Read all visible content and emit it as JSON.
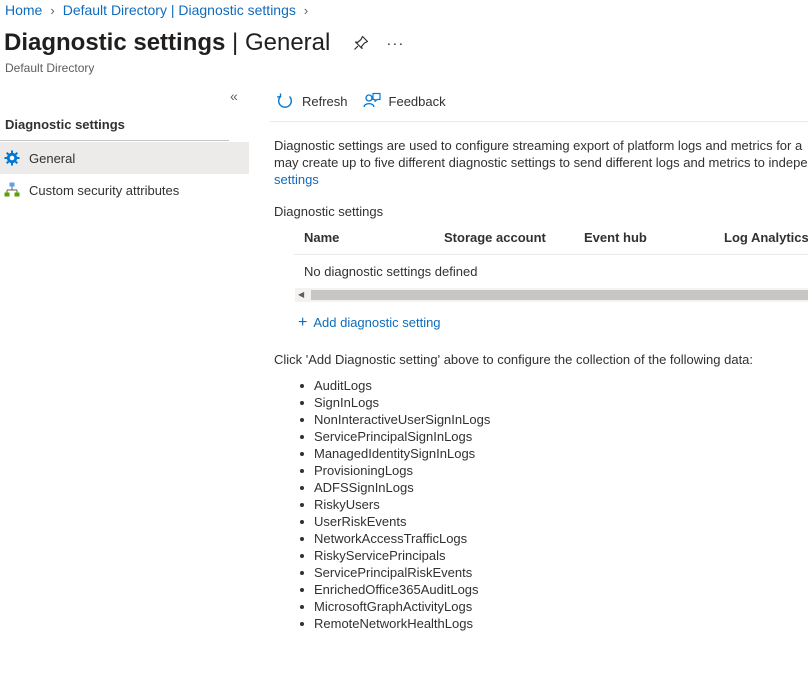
{
  "breadcrumb": {
    "items": [
      "Home",
      "Default Directory | Diagnostic settings"
    ]
  },
  "header": {
    "title_main": "Diagnostic settings",
    "title_separator": " | ",
    "title_sub": "General",
    "more_label": "···",
    "subtitle": "Default Directory"
  },
  "sidebar": {
    "collapse_label": "«",
    "section_title": "Diagnostic settings",
    "items": [
      {
        "label": "General",
        "icon": "gear-icon",
        "active": true
      },
      {
        "label": "Custom security attributes",
        "icon": "hierarchy-icon",
        "active": false
      }
    ]
  },
  "toolbar": {
    "refresh_label": "Refresh",
    "feedback_label": "Feedback"
  },
  "main": {
    "description_line1": "Diagnostic settings are used to configure streaming export of platform logs and metrics for a",
    "description_line2": "may create up to five different diagnostic settings to send different logs and metrics to indepe",
    "description_link": "settings",
    "table_section_label": "Diagnostic settings",
    "table_columns": [
      "Name",
      "Storage account",
      "Event hub",
      "Log Analytics w"
    ],
    "empty_message": "No diagnostic settings defined",
    "add_setting_label": "Add diagnostic setting",
    "instructions": "Click 'Add Diagnostic setting' above to configure the collection of the following data:",
    "log_items": [
      "AuditLogs",
      "SignInLogs",
      "NonInteractiveUserSignInLogs",
      "ServicePrincipalSignInLogs",
      "ManagedIdentitySignInLogs",
      "ProvisioningLogs",
      "ADFSSignInLogs",
      "RiskyUsers",
      "UserRiskEvents",
      "NetworkAccessTrafficLogs",
      "RiskyServicePrincipals",
      "ServicePrincipalRiskEvents",
      "EnrichedOffice365AuditLogs",
      "MicrosoftGraphActivityLogs",
      "RemoteNetworkHealthLogs"
    ]
  },
  "colors": {
    "link": "#0f6cbd",
    "active_nav_bg": "#edebe9",
    "gear_icon": "#0078d4"
  }
}
